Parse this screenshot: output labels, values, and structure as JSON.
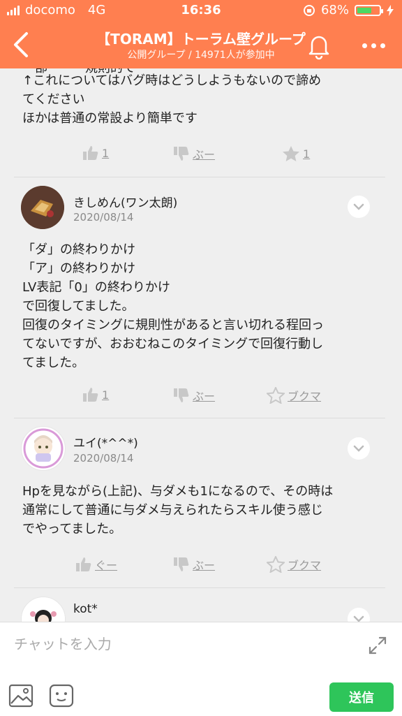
{
  "status_bar": {
    "carrier": "docomo",
    "network": "4G",
    "time": "16:36",
    "battery": "68%",
    "battery_level": 0.68
  },
  "header": {
    "title": "【TORAM】トーラム壁グループ",
    "subtitle": "公開グループ / 14971人が参加中",
    "icons": [
      "back-icon",
      "bell-icon",
      "more-icon"
    ]
  },
  "posts": [
    {
      "partial_top_line": "ー部・・・規則的でー",
      "body": "↑これについてはバグ時はどうしようもないので諦め\nてください\nほかは普通の常設より簡単です",
      "reactions": {
        "good": "1",
        "boo": "ぶー",
        "star": "1"
      }
    },
    {
      "user": "きしめん(ワン太朗)",
      "date": "2020/08/14",
      "body": "「ダ」の終わりかけ\n「ア」の終わりかけ\nLV表記「0」の終わりかけ\nで回復してました。\n回復のタイミングに規則性があると言い切れる程回っ\nてないですが、おおむねこのタイミングで回復行動し\nてました。",
      "reactions": {
        "good": "1",
        "boo": "ぶー",
        "star": "ブクマ"
      }
    },
    {
      "user": "ユイ(*^^*)",
      "date": "2020/08/14",
      "body": "Hpを見ながら(上記)、与ダメも1になるので、その時は\n通常にして普通に与ダメ与えられたらスキル使う感じ\nでやってました。",
      "reactions": {
        "good": "ぐー",
        "boo": "ぶー",
        "star": "ブクマ"
      }
    },
    {
      "user": "kot*"
    }
  ],
  "input": {
    "placeholder": "チャットを入力",
    "send": "送信"
  },
  "colors": {
    "header": "#ff7f50",
    "send": "#2ec55a",
    "background": "#efefef"
  }
}
